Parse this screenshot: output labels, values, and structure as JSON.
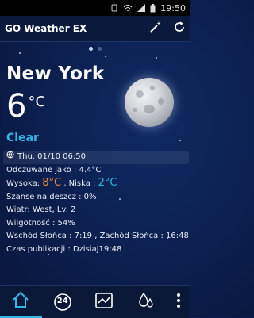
{
  "status_bar": {
    "time": "19:50"
  },
  "app": {
    "title": "GO Weather EX"
  },
  "weather": {
    "city": "New York",
    "temperature": "6",
    "unit": "°C",
    "condition": "Clear",
    "datetime": "Thu. 01/10 06:50",
    "feels_like": "Odczuwane jako : 4.4°C",
    "high_label": "Wysoka:",
    "high_value": "8°C",
    "low_label": ", Niska :",
    "low_value": "2°C",
    "rain_chance": "Szanse na deszcz : 0%",
    "wind": "Wiatr: West, Lv. 2",
    "humidity": "Wilgotność : 54%",
    "sun": "Wschód Słońca : 7:19 , Zachód Słońca : 16:48",
    "published": "Czas publikacji : Dzisiaj19:48"
  },
  "pager": {
    "pages": 2,
    "active": 0
  },
  "bottom_tabs": [
    {
      "icon": "home-icon"
    },
    {
      "icon": "24-hour-icon",
      "label": "24"
    },
    {
      "icon": "trend-chart-icon"
    },
    {
      "icon": "precipitation-icon"
    }
  ],
  "colors": {
    "accent": "#33b5e5",
    "high": "#f0883e",
    "background": "#0b1f4d"
  }
}
